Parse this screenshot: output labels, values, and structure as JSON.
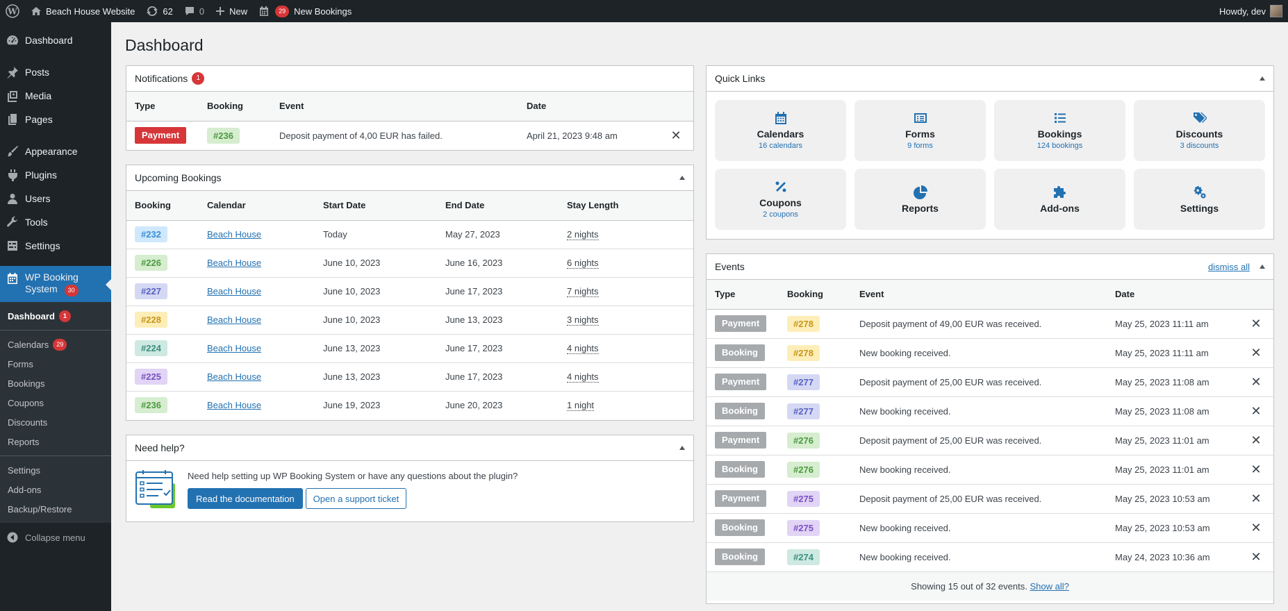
{
  "adminbar": {
    "site_name": "Beach House Website",
    "updates_count": "62",
    "comments_count": "0",
    "new_label": "New",
    "bookings_count": "29",
    "bookings_label": "New Bookings",
    "howdy": "Howdy, dev"
  },
  "sidebar": {
    "items": [
      {
        "label": "Dashboard",
        "icon": "dashboard-icon"
      },
      {
        "label": "Posts",
        "icon": "pin-icon"
      },
      {
        "label": "Media",
        "icon": "media-icon"
      },
      {
        "label": "Pages",
        "icon": "pages-icon"
      },
      {
        "label": "Appearance",
        "icon": "brush-icon"
      },
      {
        "label": "Plugins",
        "icon": "plugin-icon"
      },
      {
        "label": "Users",
        "icon": "user-icon"
      },
      {
        "label": "Tools",
        "icon": "wrench-icon"
      },
      {
        "label": "Settings",
        "icon": "settings-icon"
      }
    ],
    "current_label_1": "WP Booking",
    "current_label_2": "System",
    "current_badge": "30",
    "sub_dashboard": "Dashboard",
    "sub_dashboard_badge": "1",
    "sub_calendars": "Calendars",
    "sub_calendars_badge": "29",
    "sub_forms": "Forms",
    "sub_bookings": "Bookings",
    "sub_coupons": "Coupons",
    "sub_discounts": "Discounts",
    "sub_reports": "Reports",
    "sub_settings": "Settings",
    "sub_addons": "Add-ons",
    "sub_backup": "Backup/Restore",
    "collapse": "Collapse menu"
  },
  "page_title": "Dashboard",
  "notifications": {
    "title": "Notifications",
    "count": "1",
    "headers": [
      "Type",
      "Booking",
      "Event",
      "Date"
    ],
    "rows": [
      {
        "type": "Payment",
        "booking": "#236",
        "event": "Deposit payment of 4,00 EUR has failed.",
        "date": "April 21, 2023 9:48 am"
      }
    ]
  },
  "upcoming": {
    "title": "Upcoming Bookings",
    "headers": [
      "Booking",
      "Calendar",
      "Start Date",
      "End Date",
      "Stay Length"
    ],
    "rows": [
      {
        "booking": "#232",
        "calendar": "Beach House",
        "start": "Today",
        "end": "May 27, 2023",
        "stay": "2 nights",
        "bg": "#cfe8fc",
        "fg": "#3a8fd6"
      },
      {
        "booking": "#226",
        "calendar": "Beach House",
        "start": "June 10, 2023",
        "end": "June 16, 2023",
        "stay": "6 nights",
        "bg": "#d6edd0",
        "fg": "#4b9a3e"
      },
      {
        "booking": "#227",
        "calendar": "Beach House",
        "start": "June 10, 2023",
        "end": "June 17, 2023",
        "stay": "7 nights",
        "bg": "#d5d8f3",
        "fg": "#5862c5"
      },
      {
        "booking": "#228",
        "calendar": "Beach House",
        "start": "June 10, 2023",
        "end": "June 13, 2023",
        "stay": "3 nights",
        "bg": "#fdeeb8",
        "fg": "#c8961a"
      },
      {
        "booking": "#224",
        "calendar": "Beach House",
        "start": "June 13, 2023",
        "end": "June 17, 2023",
        "stay": "4 nights",
        "bg": "#cde9e2",
        "fg": "#3a8f7c"
      },
      {
        "booking": "#225",
        "calendar": "Beach House",
        "start": "June 13, 2023",
        "end": "June 17, 2023",
        "stay": "4 nights",
        "bg": "#e1d4f5",
        "fg": "#7a4fc2"
      },
      {
        "booking": "#236",
        "calendar": "Beach House",
        "start": "June 19, 2023",
        "end": "June 20, 2023",
        "stay": "1 night",
        "bg": "#d6edd0",
        "fg": "#4b9a3e"
      }
    ]
  },
  "help": {
    "title": "Need help?",
    "text": "Need help setting up WP Booking System or have any questions about the plugin?",
    "docs_button": "Read the documentation",
    "ticket_button": "Open a support ticket"
  },
  "quick_links": {
    "title": "Quick Links",
    "items": [
      {
        "title": "Calendars",
        "sub": "16 calendars",
        "icon": "calendar-icon"
      },
      {
        "title": "Forms",
        "sub": "9 forms",
        "icon": "form-icon"
      },
      {
        "title": "Bookings",
        "sub": "124 bookings",
        "icon": "list-icon"
      },
      {
        "title": "Discounts",
        "sub": "3 discounts",
        "icon": "tags-icon"
      },
      {
        "title": "Coupons",
        "sub": "2 coupons",
        "icon": "percent-icon"
      },
      {
        "title": "Reports",
        "sub": "",
        "icon": "pie-chart-icon"
      },
      {
        "title": "Add-ons",
        "sub": "",
        "icon": "puzzle-icon"
      },
      {
        "title": "Settings",
        "sub": "",
        "icon": "cogs-icon"
      }
    ]
  },
  "events": {
    "title": "Events",
    "dismiss": "dismiss all",
    "headers": [
      "Type",
      "Booking",
      "Event",
      "Date"
    ],
    "rows": [
      {
        "type": "Payment",
        "booking": "#278",
        "event": "Deposit payment of 49,00 EUR was received.",
        "date": "May 25, 2023 11:11 am",
        "bg": "#fdeeb8",
        "fg": "#c8961a"
      },
      {
        "type": "Booking",
        "booking": "#278",
        "event": "New booking received.",
        "date": "May 25, 2023 11:11 am",
        "bg": "#fdeeb8",
        "fg": "#c8961a"
      },
      {
        "type": "Payment",
        "booking": "#277",
        "event": "Deposit payment of 25,00 EUR was received.",
        "date": "May 25, 2023 11:08 am",
        "bg": "#d5d8f3",
        "fg": "#5862c5"
      },
      {
        "type": "Booking",
        "booking": "#277",
        "event": "New booking received.",
        "date": "May 25, 2023 11:08 am",
        "bg": "#d5d8f3",
        "fg": "#5862c5"
      },
      {
        "type": "Payment",
        "booking": "#276",
        "event": "Deposit payment of 25,00 EUR was received.",
        "date": "May 25, 2023 11:01 am",
        "bg": "#d6edd0",
        "fg": "#4b9a3e"
      },
      {
        "type": "Booking",
        "booking": "#276",
        "event": "New booking received.",
        "date": "May 25, 2023 11:01 am",
        "bg": "#d6edd0",
        "fg": "#4b9a3e"
      },
      {
        "type": "Payment",
        "booking": "#275",
        "event": "Deposit payment of 25,00 EUR was received.",
        "date": "May 25, 2023 10:53 am",
        "bg": "#e1d4f5",
        "fg": "#7a4fc2"
      },
      {
        "type": "Booking",
        "booking": "#275",
        "event": "New booking received.",
        "date": "May 25, 2023 10:53 am",
        "bg": "#e1d4f5",
        "fg": "#7a4fc2"
      },
      {
        "type": "Booking",
        "booking": "#274",
        "event": "New booking received.",
        "date": "May 24, 2023 10:36 am",
        "bg": "#cde9e2",
        "fg": "#3a8f7c"
      }
    ],
    "footer_text": "Showing 15 out of 32 events.",
    "footer_link": "Show all?"
  },
  "colors": {
    "payment_failed": "#d63638",
    "event_type": "#a7aaad",
    "accent": "#2271b1",
    "notif_booking_bg": "#d6edd0",
    "notif_booking_fg": "#4b9a3e"
  }
}
